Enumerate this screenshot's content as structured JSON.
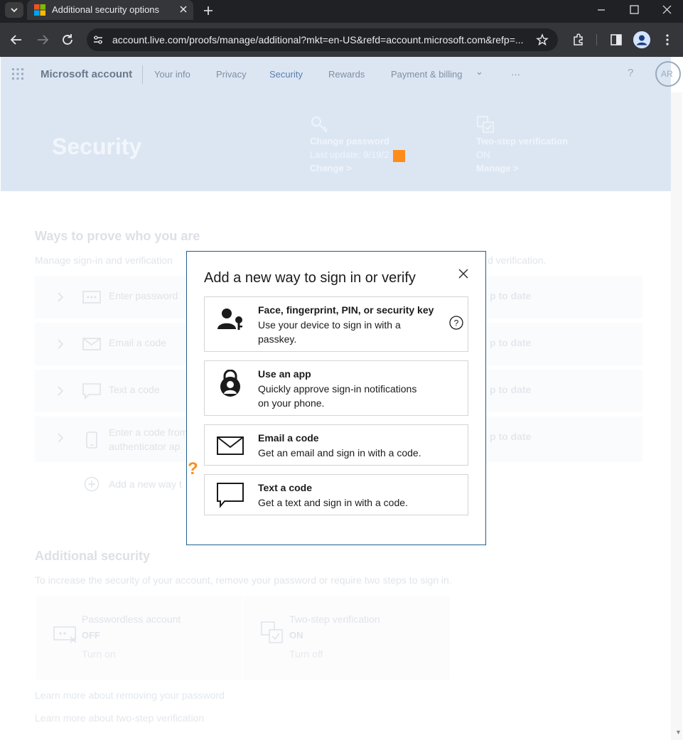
{
  "browser": {
    "tab_title": "Additional security options",
    "url": "account.live.com/proofs/manage/additional?mkt=en-US&refd=account.microsoft.com&refp=..."
  },
  "nav": {
    "brand": "Microsoft account",
    "links": [
      "Your info",
      "Privacy",
      "Security",
      "Rewards",
      "Payment & billing",
      "⌄",
      "···"
    ],
    "help": "?",
    "avatar_initials": "AR"
  },
  "hero": {
    "title": "Security",
    "password": {
      "title": "Change password",
      "subtitle": "Last update: 9/19/2",
      "link": "Change >"
    },
    "two_step": {
      "title": "Two-step verification",
      "subtitle": "ON",
      "link": "Manage >"
    }
  },
  "proof_section": {
    "title": "Ways to prove who you are",
    "subtitle_left": "Manage sign-in and verification",
    "subtitle_right": "d verification.",
    "rows": [
      {
        "label": "Enter password",
        "status": "p to date",
        "icon": "password-icon"
      },
      {
        "label": "Email a code",
        "status": "p to date",
        "icon": "mail-icon"
      },
      {
        "label": "Text a code",
        "status": "p to date",
        "icon": "chat-icon"
      },
      {
        "label": "Enter a code from",
        "label2": "authenticator ap",
        "status": "p to date",
        "icon": "phone-icon"
      }
    ],
    "add_label": "Add a new way t"
  },
  "additional_section": {
    "title": "Additional security",
    "subtitle": "To increase the security of your account, remove your password or require two steps to sign in.",
    "cards": [
      {
        "title": "Passwordless account",
        "state": "OFF",
        "action": "Turn on",
        "icon": "passwordless-icon"
      },
      {
        "title": "Two-step verification",
        "state": "ON",
        "action": "Turn off",
        "icon": "two-step-icon"
      }
    ],
    "learn_links": [
      "Learn more about removing your password",
      "Learn more about two-step verification"
    ]
  },
  "modal": {
    "title": "Add a new way to sign in or verify",
    "options": [
      {
        "title": "Face, fingerprint, PIN, or security key",
        "desc1": "Use your device to sign in with a",
        "desc2": "passkey.",
        "icon": "passkey-icon"
      },
      {
        "title": "Use an app",
        "desc1": "Quickly approve sign-in notifications",
        "desc2": "on your phone.",
        "icon": "authenticator-app-icon"
      },
      {
        "title": "Email a code",
        "desc1": "Get an email and sign in with a code.",
        "icon": "envelope-icon"
      },
      {
        "title": "Text a code",
        "desc1": "Get a text and sign in with a code.",
        "icon": "speech-bubble-icon"
      }
    ]
  },
  "annotation": {
    "question_mark": "?"
  },
  "colors": {
    "accent": "#ff8c1a",
    "modal_border": "#1f5f8f",
    "hero_bg": "#dce6f3"
  }
}
